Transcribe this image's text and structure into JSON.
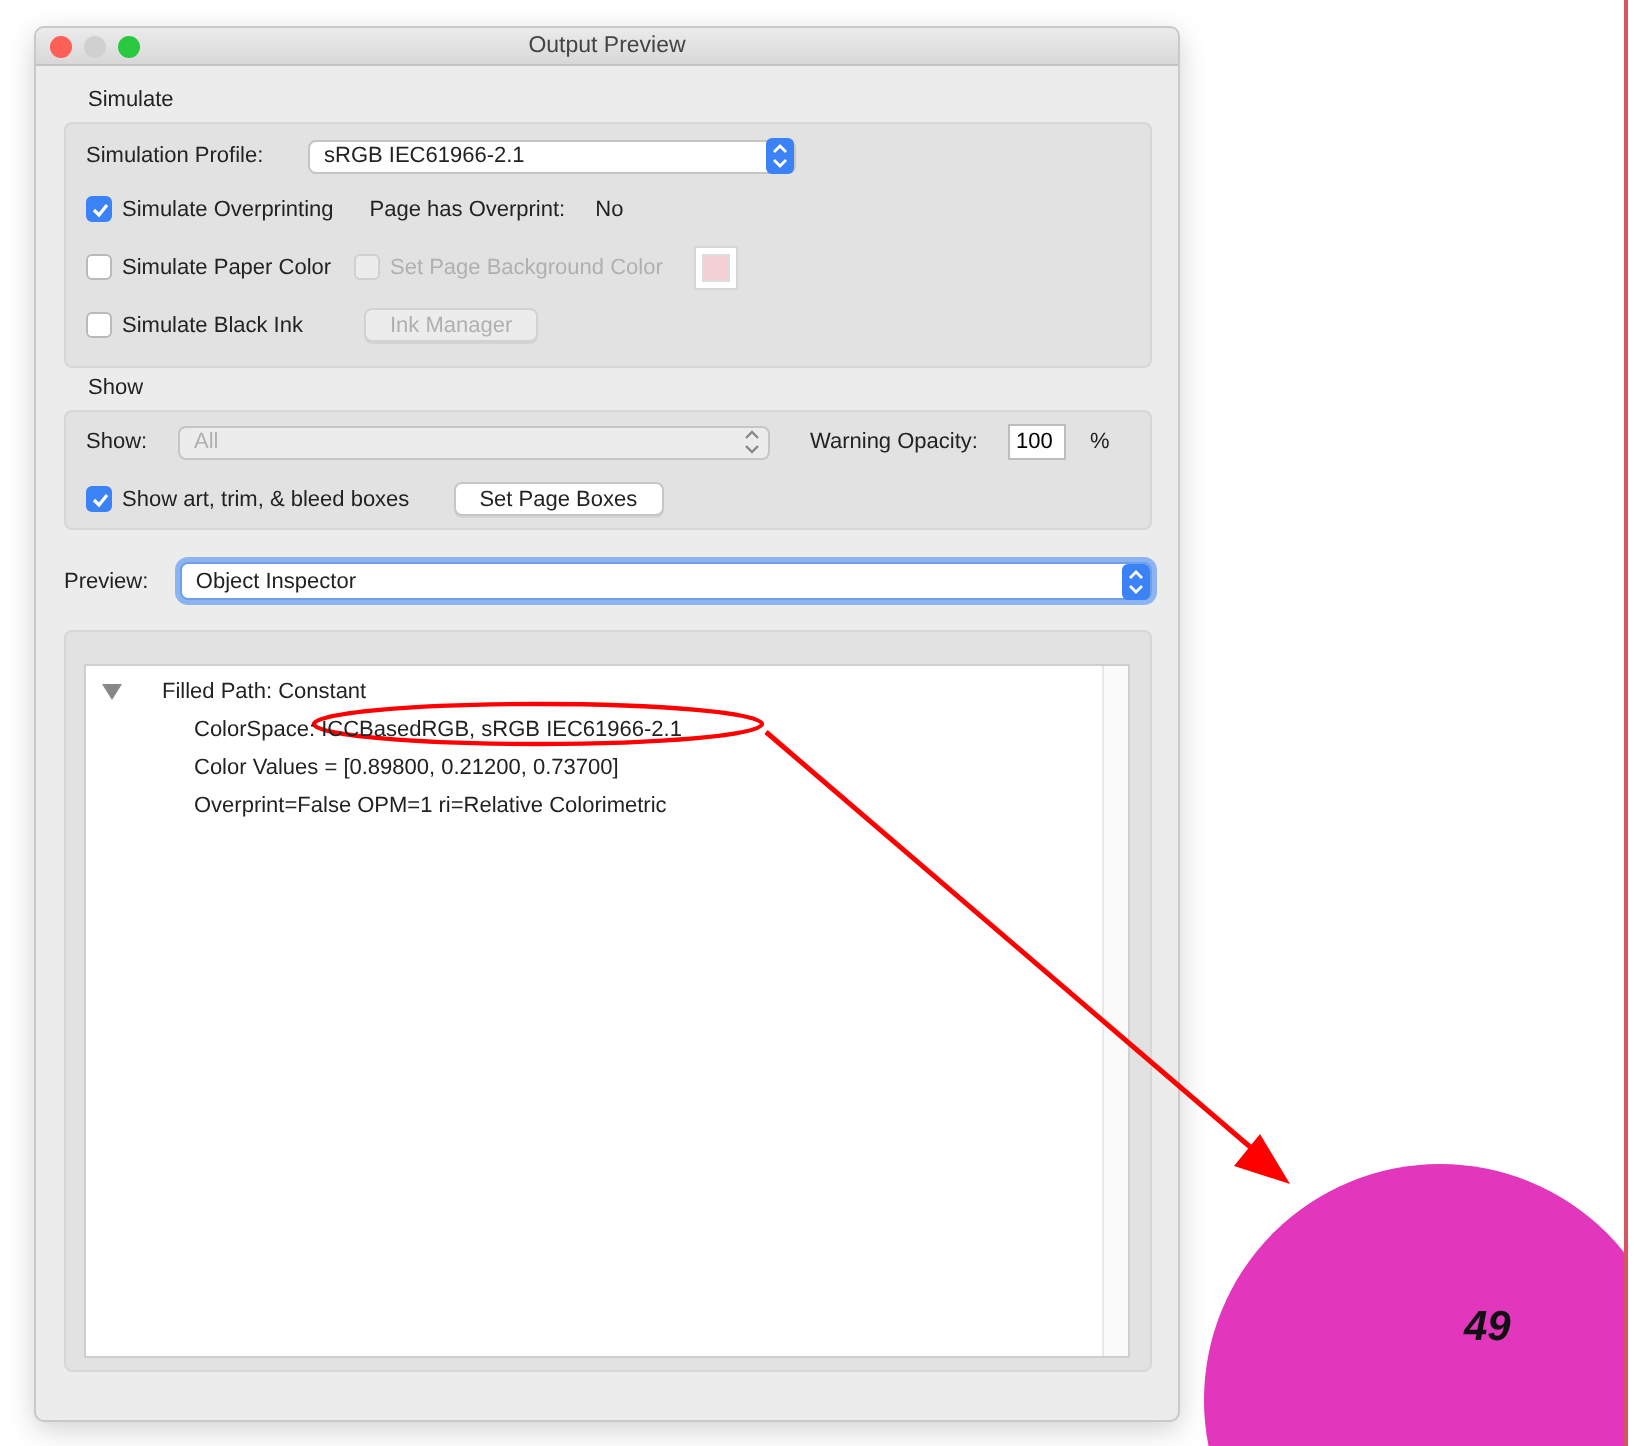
{
  "window": {
    "title": "Output Preview"
  },
  "simulate": {
    "heading": "Simulate",
    "profile_label": "Simulation Profile:",
    "profile_value": "sRGB IEC61966-2.1",
    "overprint": {
      "label": "Simulate Overprinting",
      "checked": true
    },
    "page_overprint_label": "Page has Overprint:",
    "page_overprint_value": "No",
    "paper_color": {
      "label": "Simulate Paper Color",
      "checked": false
    },
    "page_background": {
      "label": "Set Page Background Color",
      "checked": false,
      "disabled": true,
      "color": "#f2d0d6"
    },
    "black_ink": {
      "label": "Simulate Black Ink",
      "checked": false
    },
    "ink_manager_button": {
      "label": "Ink Manager",
      "disabled": true
    }
  },
  "show": {
    "heading": "Show",
    "show_label": "Show:",
    "show_value": "All",
    "show_disabled": true,
    "opacity_label": "Warning Opacity:",
    "opacity_value": "100",
    "percent": "%",
    "boxes": {
      "label": "Show art, trim, & bleed boxes",
      "checked": true
    },
    "set_boxes_button": "Set Page Boxes"
  },
  "preview": {
    "label": "Preview:",
    "value": "Object Inspector"
  },
  "inspector": {
    "tree": [
      {
        "label": "Filled Path: Constant",
        "expanded": true,
        "children": [
          {
            "label": "ColorSpace: ICCBasedRGB, sRGB IEC61966-2.1"
          },
          {
            "label": "Color Values = [0.89800, 0.21200, 0.73700]"
          },
          {
            "label": "Overprint=False OPM=1 ri=Relative Colorimetric"
          }
        ]
      }
    ]
  },
  "page": {
    "number": "49"
  }
}
